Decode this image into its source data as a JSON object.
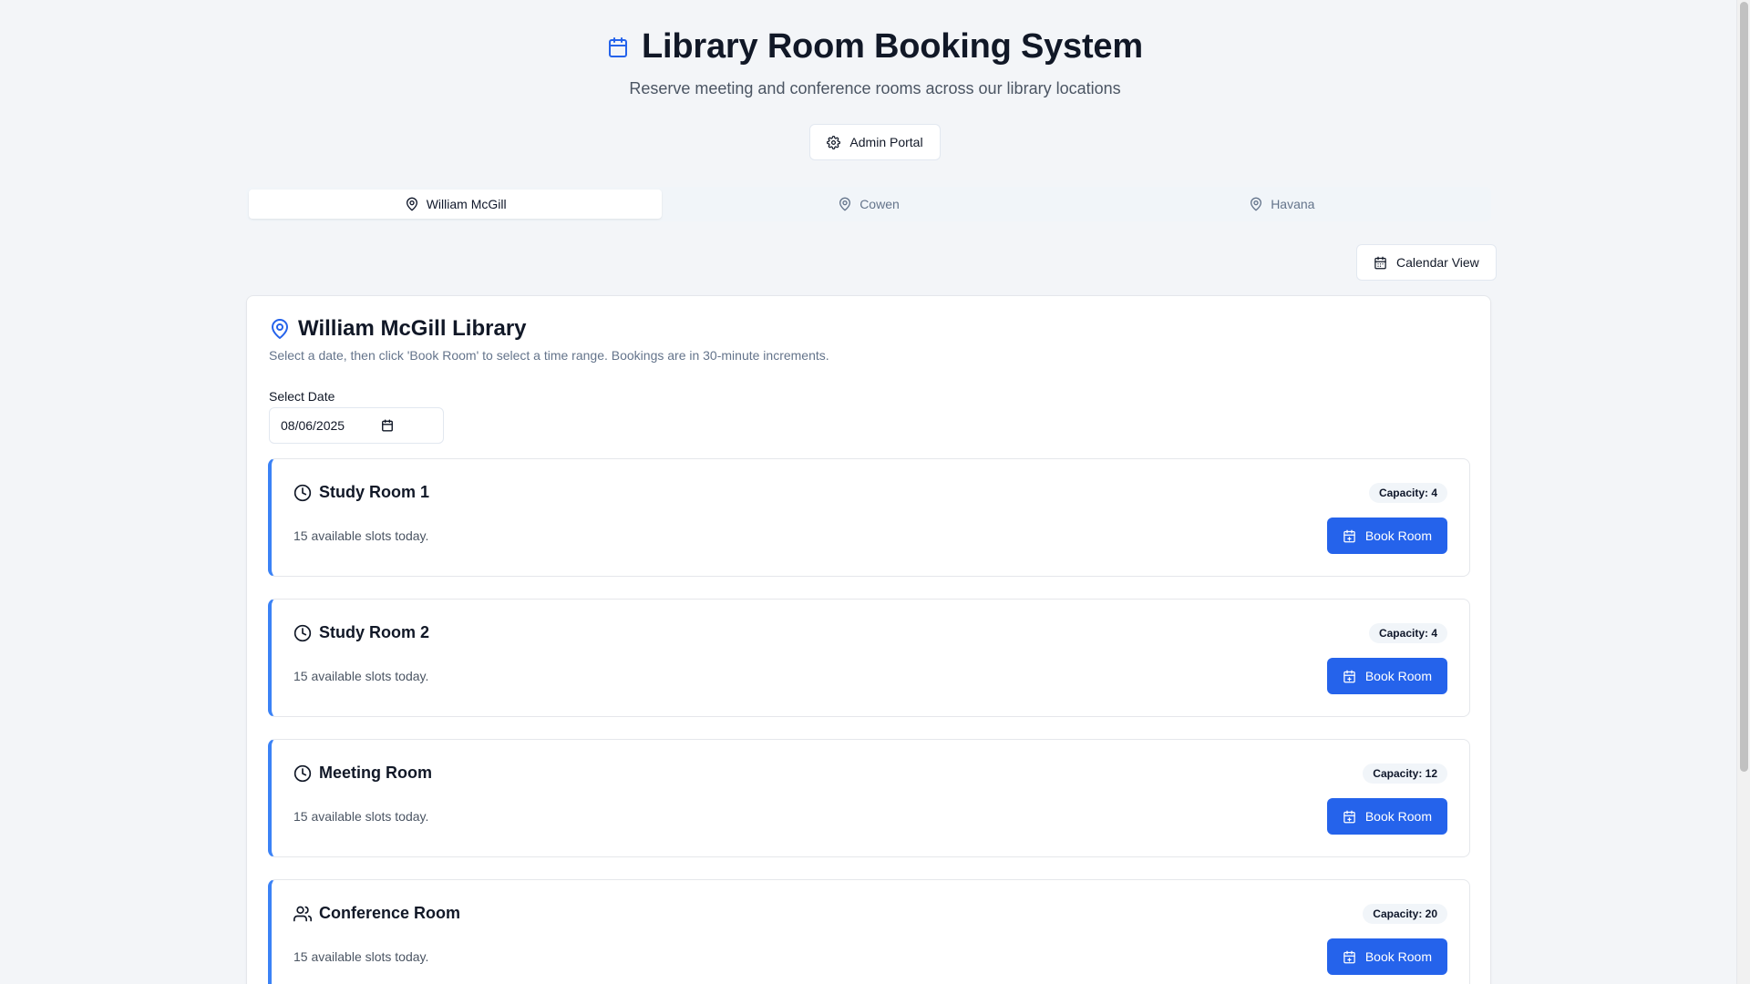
{
  "header": {
    "title": "Library Room Booking System",
    "subtitle": "Reserve meeting and conference rooms across our library locations",
    "title_icon": "calendar-icon"
  },
  "admin_button": {
    "label": "Admin Portal",
    "icon": "gear-icon"
  },
  "tabs": [
    {
      "label": "William McGill",
      "icon": "map-pin-icon",
      "active": true
    },
    {
      "label": "Cowen",
      "icon": "map-pin-icon",
      "active": false
    },
    {
      "label": "Havana",
      "icon": "map-pin-icon",
      "active": false
    }
  ],
  "calendar_view": {
    "label": "Calendar View",
    "icon": "calendar-icon"
  },
  "library": {
    "title": "William McGill Library",
    "description": "Select a date, then click 'Book Room' to select a time range. Bookings are in 30-minute increments.",
    "date_label": "Select Date",
    "date_value": "08/06/2025"
  },
  "rooms": [
    {
      "name": "Study Room 1",
      "icon": "clock-icon",
      "capacity": "Capacity: 4",
      "slots": "15 available slots today.",
      "button": "Book Room"
    },
    {
      "name": "Study Room 2",
      "icon": "clock-icon",
      "capacity": "Capacity: 4",
      "slots": "15 available slots today.",
      "button": "Book Room"
    },
    {
      "name": "Meeting Room",
      "icon": "clock-icon",
      "capacity": "Capacity: 12",
      "slots": "15 available slots today.",
      "button": "Book Room"
    },
    {
      "name": "Conference Room",
      "icon": "users-icon",
      "capacity": "Capacity: 20",
      "slots": "15 available slots today.",
      "button": "Book Room"
    }
  ],
  "colors": {
    "accent": "#2563eb",
    "room_border": "#3b82f6",
    "background": "#f3f5f8"
  }
}
